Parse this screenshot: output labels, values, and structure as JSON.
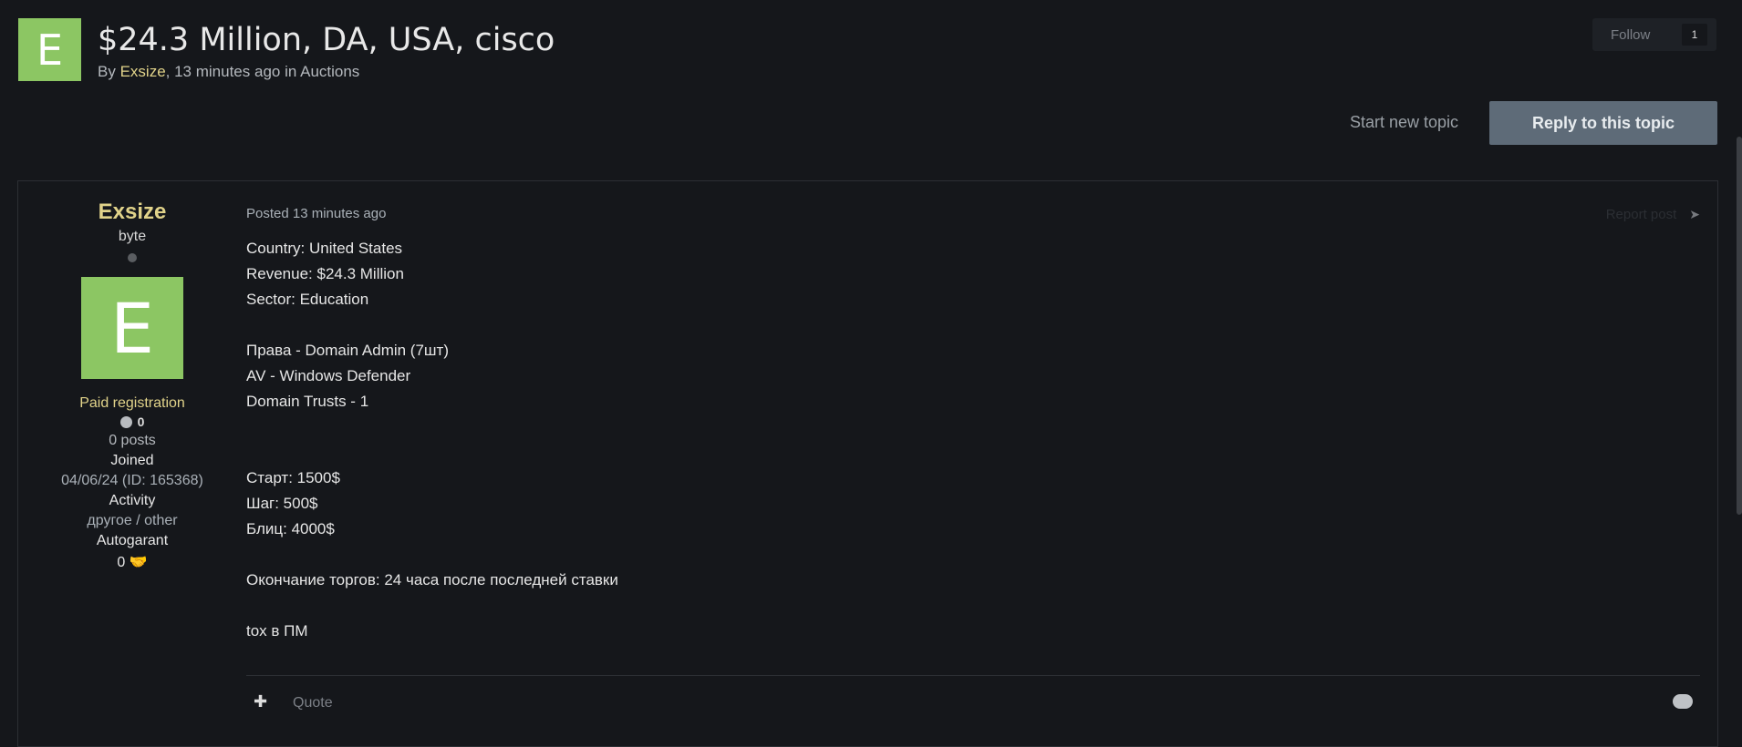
{
  "topic": {
    "avatar_letter": "E",
    "title": "$24.3 Million, DA, USA, cisco",
    "by": "By",
    "author": "Exsize",
    "time": ", 13 minutes ago in",
    "forum": "Auctions"
  },
  "follow": {
    "label": "Follow",
    "count": "1"
  },
  "actions": {
    "start_new": "Start new topic",
    "reply": "Reply to this topic"
  },
  "post": {
    "author": {
      "name": "Exsize",
      "group": "byte",
      "avatar_letter": "E",
      "title": "Paid registration",
      "reputation": "0",
      "posts": "0 posts",
      "joined_label": "Joined",
      "joined_value": "04/06/24 (ID: 165368)",
      "activity_label": "Activity",
      "activity_value": "другое / other",
      "guarant_label": "Autogarant",
      "guarant_value": "0"
    },
    "posted": "Posted 13 minutes ago",
    "report": "Report post",
    "lines": [
      "Country: United States",
      "Revenue: $24.3 Million",
      "Sector: Education",
      "",
      "Права - Domain Admin (7шт)",
      "AV - Windows Defender",
      "Domain Trusts - 1",
      "",
      "",
      "Старт: 1500$",
      "Шаг: 500$",
      "Блиц: 4000$",
      "",
      "Окончание торгов: 24 часа после последней ставки",
      "",
      "tox в ПМ"
    ],
    "quote": "Quote"
  },
  "colors": {
    "accent_yellow": "#e1d38a",
    "avatar_green": "#8cc663",
    "reply_button": "#5e6b78",
    "background": "#15171b"
  },
  "icons": [
    "share-icon",
    "plus-icon",
    "reaction-icon",
    "handshake-icon"
  ]
}
